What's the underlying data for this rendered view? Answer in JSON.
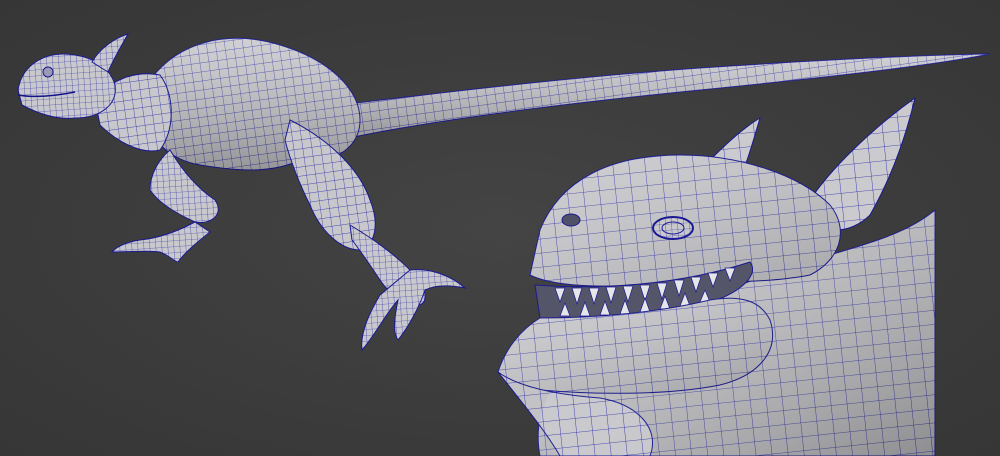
{
  "viewport": {
    "mode": "wireframe-on-shaded",
    "background": "#3c3c3c",
    "mesh_color": "#c9c9cd",
    "wire_color": "#1a1a9e"
  },
  "models": [
    {
      "name": "dinosaur-full-body",
      "view": "side"
    },
    {
      "name": "dinosaur-head",
      "view": "close-up"
    }
  ]
}
